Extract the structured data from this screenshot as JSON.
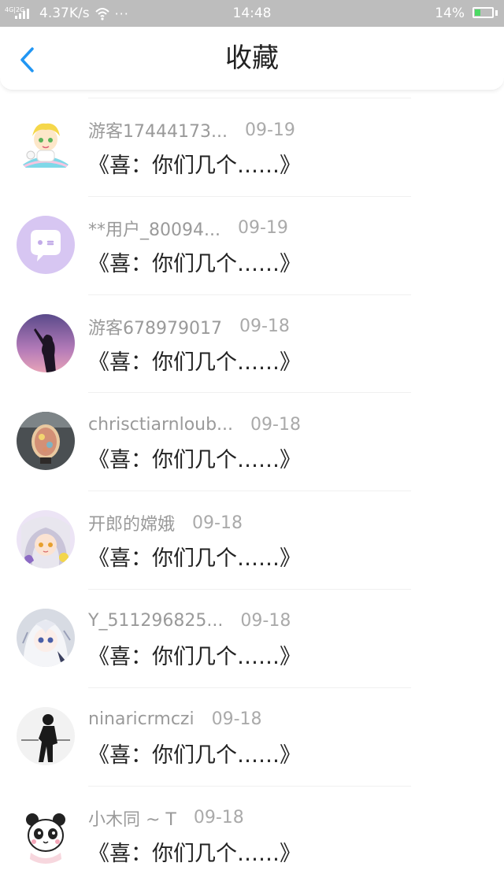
{
  "status_bar": {
    "network": "4G|2G",
    "speed": "4.37K/s",
    "dots": "···",
    "time": "14:48",
    "battery": "14%",
    "icons": [
      "signal-icon",
      "wifi-icon",
      "more-dots-icon",
      "battery-charging-icon"
    ]
  },
  "header": {
    "back_icon": "back-chevron-icon",
    "title": "收藏",
    "accent_color": "#2196f3"
  },
  "favorites": [
    {
      "username": "游客17444173...",
      "date": "09-19",
      "content": "《喜：你们几个……》",
      "avatar": "cartoon-avatar"
    },
    {
      "username": "**用户_80094...",
      "date": "09-19",
      "content": "《喜：你们几个……》",
      "avatar": "chat-bubble-avatar"
    },
    {
      "username": "游客678979017",
      "date": "09-18",
      "content": "《喜：你们几个……》",
      "avatar": "silhouette-avatar"
    },
    {
      "username": "chrisctiarnloub...",
      "date": "09-18",
      "content": "《喜：你们几个……》",
      "avatar": "lamp-avatar"
    },
    {
      "username": "开郎的嫦娥",
      "date": "09-18",
      "content": "《喜：你们几个……》",
      "avatar": "anime-girl-avatar"
    },
    {
      "username": "Y_511296825...",
      "date": "09-18",
      "content": "《喜：你们几个……》",
      "avatar": "anime-white-hair-avatar"
    },
    {
      "username": "ninaricrmczi",
      "date": "09-18",
      "content": "《喜：你们几个……》",
      "avatar": "bw-photo-avatar"
    },
    {
      "username": "小木同 ~ T",
      "date": "09-18",
      "content": "《喜：你们几个……》",
      "avatar": "panda-avatar"
    }
  ]
}
